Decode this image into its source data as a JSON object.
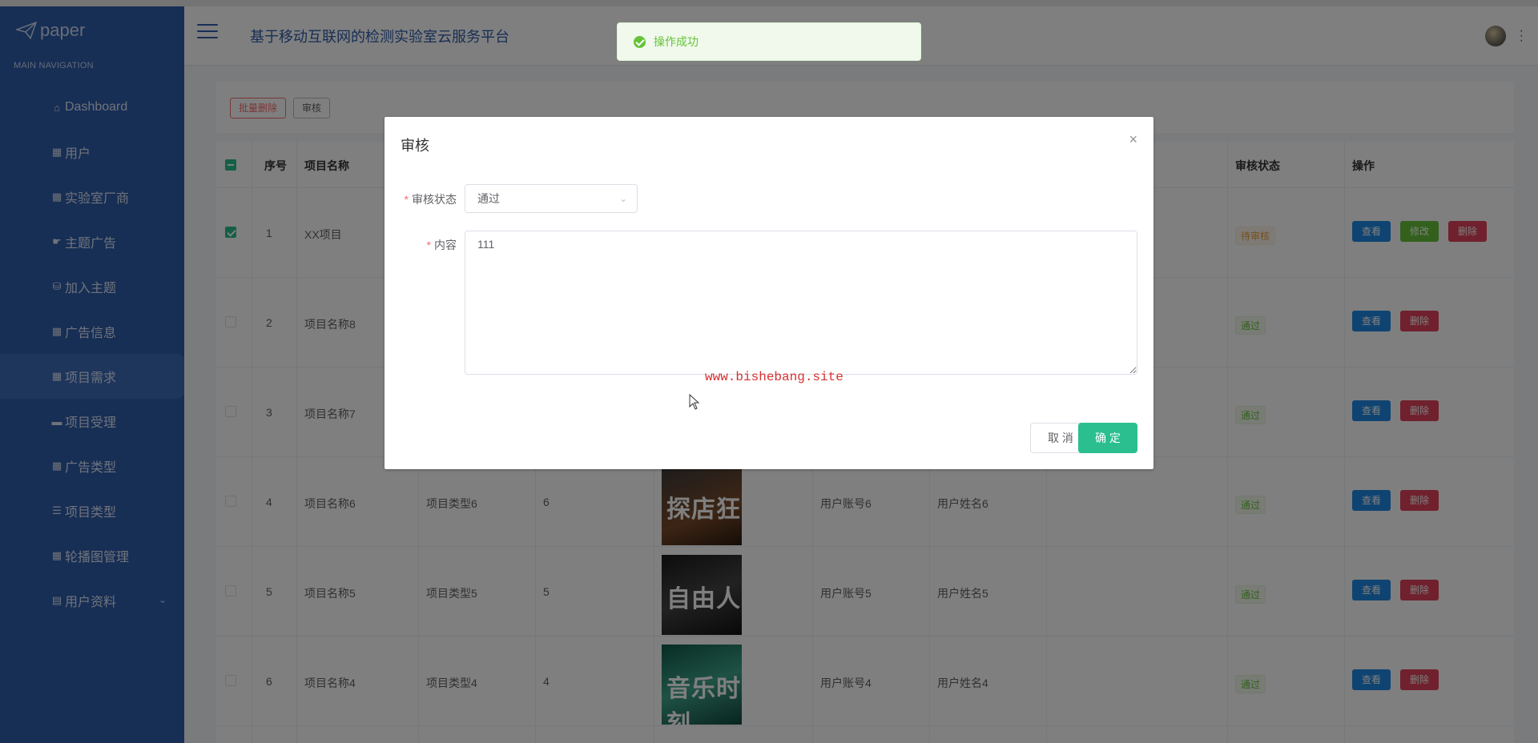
{
  "app": {
    "logo_text": "paper",
    "system_title": "基于移动互联网的检测实验室云服务平台"
  },
  "sidebar": {
    "caption": "MAIN NAVIGATION",
    "items": [
      {
        "label": "Dashboard",
        "icon": "home-icon"
      },
      {
        "label": "用户",
        "icon": "grid-icon"
      },
      {
        "label": "实验室厂商",
        "icon": "grid-icon"
      },
      {
        "label": "主题广告",
        "icon": "thumb-icon"
      },
      {
        "label": "加入主题",
        "icon": "cylinder-icon"
      },
      {
        "label": "广告信息",
        "icon": "grid-icon"
      },
      {
        "label": "项目需求",
        "icon": "grid-icon"
      },
      {
        "label": "项目受理",
        "icon": "chat-icon"
      },
      {
        "label": "广告类型",
        "icon": "grid-icon"
      },
      {
        "label": "项目类型",
        "icon": "list-icon"
      },
      {
        "label": "轮播图管理",
        "icon": "grid-icon"
      },
      {
        "label": "用户资料",
        "icon": "calendar-icon"
      }
    ],
    "active_index": 6
  },
  "toolbar": {
    "batch_delete": "批量删除",
    "audit": "审核"
  },
  "table": {
    "headers": {
      "index": "序号",
      "name": "项目名称",
      "audit_status": "审核状态",
      "actions": "操作"
    },
    "rows": [
      {
        "no": "1",
        "name": "XX项目",
        "type": "",
        "qty": "",
        "account": "",
        "username": "",
        "status": "待审核",
        "checked": true
      },
      {
        "no": "2",
        "name": "项目名称8",
        "type": "",
        "qty": "",
        "account": "",
        "username": "",
        "status": "通过",
        "checked": false
      },
      {
        "no": "3",
        "name": "项目名称7",
        "type": "",
        "qty": "",
        "account": "",
        "username": "",
        "status": "通过",
        "checked": false
      },
      {
        "no": "4",
        "name": "项目名称6",
        "type": "项目类型6",
        "qty": "6",
        "account": "用户账号6",
        "username": "用户姓名6",
        "status": "通过",
        "checked": false,
        "thumb_text": "探店狂"
      },
      {
        "no": "5",
        "name": "项目名称5",
        "type": "项目类型5",
        "qty": "5",
        "account": "用户账号5",
        "username": "用户姓名5",
        "status": "通过",
        "checked": false,
        "thumb_text": "自由人"
      },
      {
        "no": "6",
        "name": "项目名称4",
        "type": "项目类型4",
        "qty": "4",
        "account": "用户账号4",
        "username": "用户姓名4",
        "status": "通过",
        "checked": false,
        "thumb_text": "音乐时刻"
      }
    ],
    "actions": {
      "view": "查看",
      "edit": "修改",
      "delete": "删除"
    }
  },
  "toast": {
    "message": "操作成功"
  },
  "dialog": {
    "title": "审核",
    "status_label": "审核状态",
    "status_value": "通过",
    "content_label": "内容",
    "content_value": "111",
    "cancel": "取 消",
    "confirm": "确 定"
  },
  "watermark": "www.bishebang.site",
  "colors": {
    "sidebar": "#2e5caa",
    "primary": "#2bbf8f",
    "danger": "#e0435a",
    "info": "#1e88e5",
    "success": "#67c23a"
  }
}
